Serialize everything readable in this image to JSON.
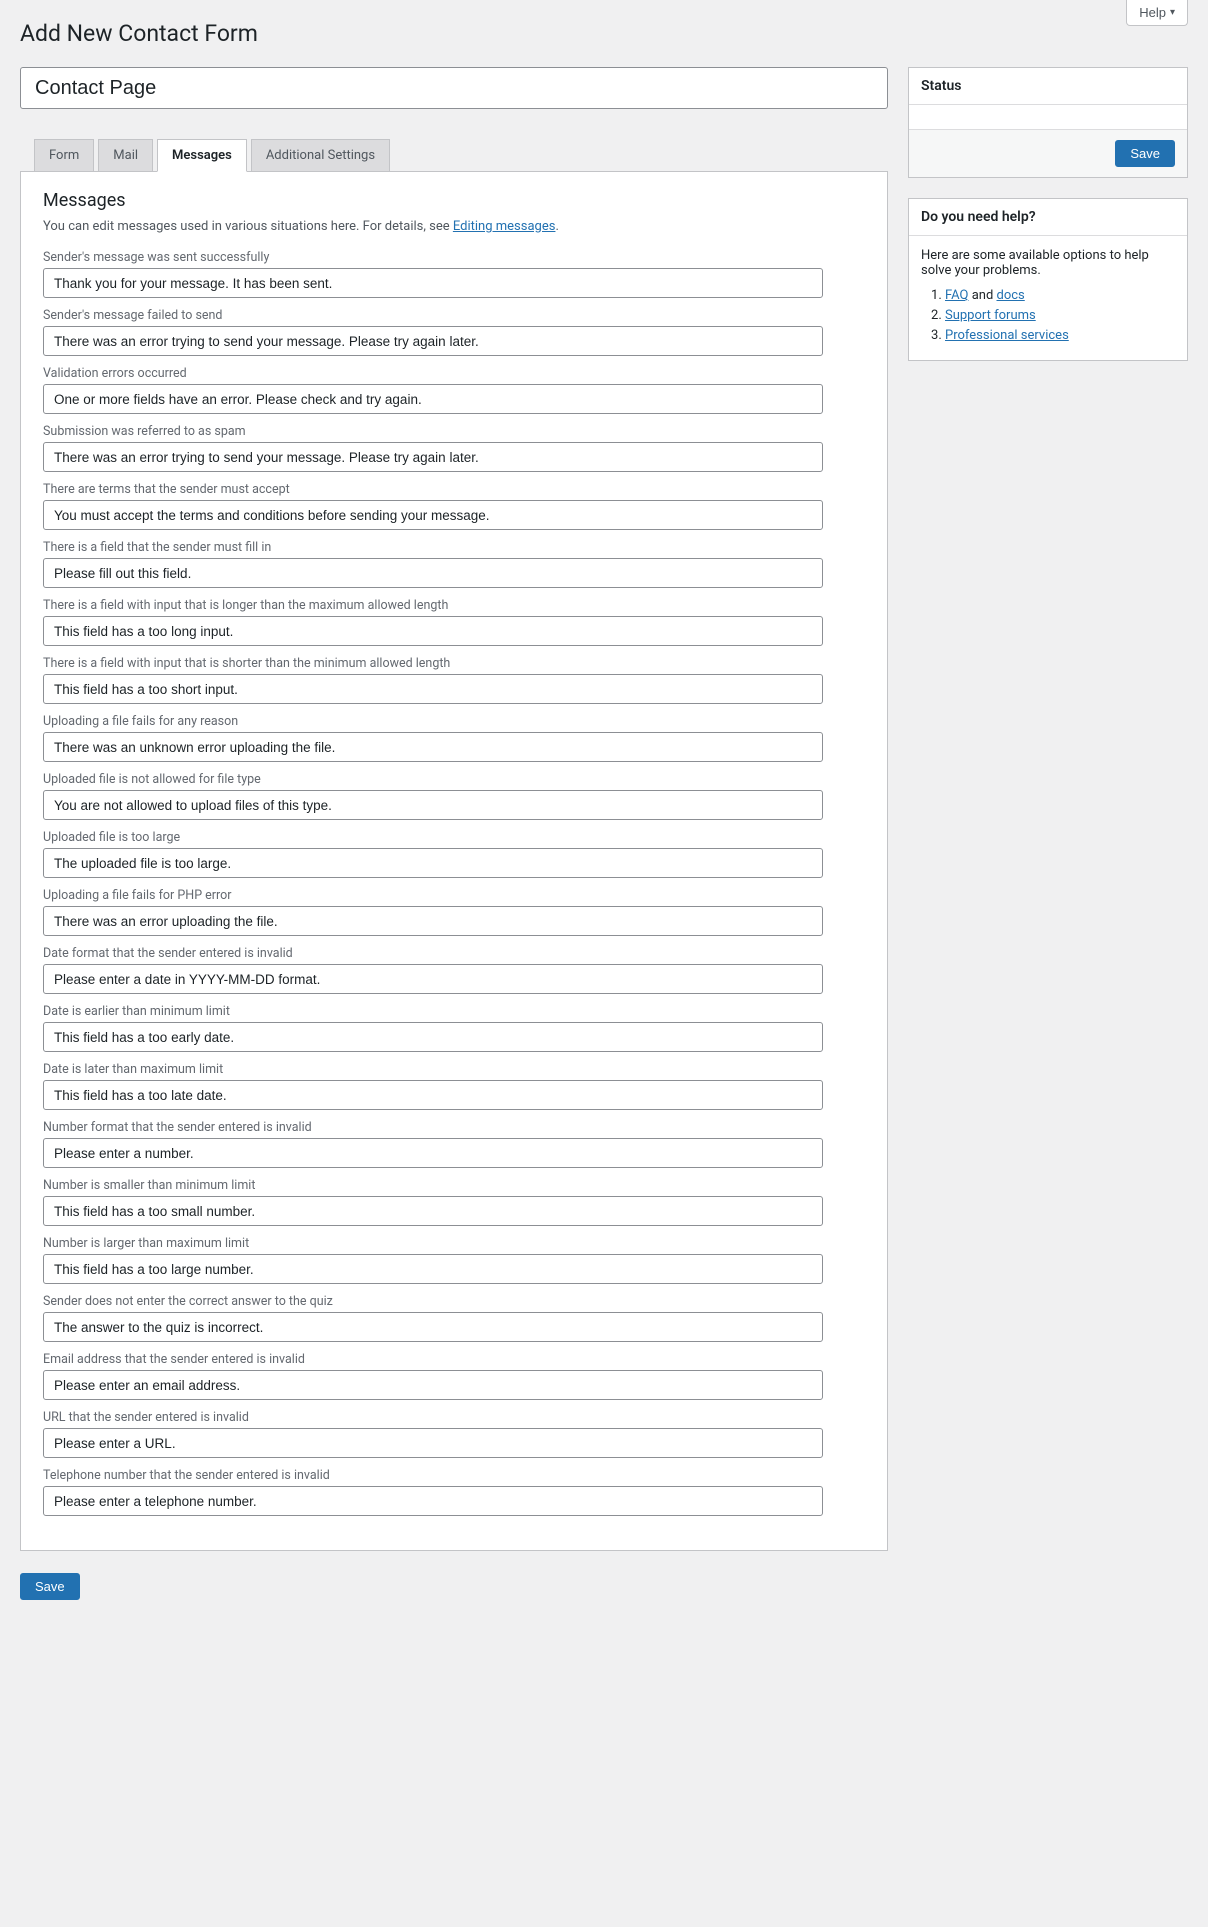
{
  "header": {
    "help_label": "Help",
    "page_title": "Add New Contact Form"
  },
  "title_field": {
    "value": "Contact Page"
  },
  "tabs": [
    {
      "label": "Form"
    },
    {
      "label": "Mail"
    },
    {
      "label": "Messages"
    },
    {
      "label": "Additional Settings"
    }
  ],
  "messages_panel": {
    "heading": "Messages",
    "desc_prefix": "You can edit messages used in various situations here. For details, see ",
    "desc_link": "Editing messages",
    "desc_suffix": ".",
    "rows": [
      {
        "label": "Sender's message was sent successfully",
        "value": "Thank you for your message. It has been sent."
      },
      {
        "label": "Sender's message failed to send",
        "value": "There was an error trying to send your message. Please try again later."
      },
      {
        "label": "Validation errors occurred",
        "value": "One or more fields have an error. Please check and try again."
      },
      {
        "label": "Submission was referred to as spam",
        "value": "There was an error trying to send your message. Please try again later."
      },
      {
        "label": "There are terms that the sender must accept",
        "value": "You must accept the terms and conditions before sending your message."
      },
      {
        "label": "There is a field that the sender must fill in",
        "value": "Please fill out this field."
      },
      {
        "label": "There is a field with input that is longer than the maximum allowed length",
        "value": "This field has a too long input."
      },
      {
        "label": "There is a field with input that is shorter than the minimum allowed length",
        "value": "This field has a too short input."
      },
      {
        "label": "Uploading a file fails for any reason",
        "value": "There was an unknown error uploading the file."
      },
      {
        "label": "Uploaded file is not allowed for file type",
        "value": "You are not allowed to upload files of this type."
      },
      {
        "label": "Uploaded file is too large",
        "value": "The uploaded file is too large."
      },
      {
        "label": "Uploading a file fails for PHP error",
        "value": "There was an error uploading the file."
      },
      {
        "label": "Date format that the sender entered is invalid",
        "value": "Please enter a date in YYYY-MM-DD format."
      },
      {
        "label": "Date is earlier than minimum limit",
        "value": "This field has a too early date."
      },
      {
        "label": "Date is later than maximum limit",
        "value": "This field has a too late date."
      },
      {
        "label": "Number format that the sender entered is invalid",
        "value": "Please enter a number."
      },
      {
        "label": "Number is smaller than minimum limit",
        "value": "This field has a too small number."
      },
      {
        "label": "Number is larger than maximum limit",
        "value": "This field has a too large number."
      },
      {
        "label": "Sender does not enter the correct answer to the quiz",
        "value": "The answer to the quiz is incorrect."
      },
      {
        "label": "Email address that the sender entered is invalid",
        "value": "Please enter an email address."
      },
      {
        "label": "URL that the sender entered is invalid",
        "value": "Please enter a URL."
      },
      {
        "label": "Telephone number that the sender entered is invalid",
        "value": "Please enter a telephone number."
      }
    ]
  },
  "sidebar": {
    "status": {
      "title": "Status",
      "save_label": "Save"
    },
    "help": {
      "title": "Do you need help?",
      "intro": "Here are some available options to help solve your problems.",
      "items": [
        {
          "link1": "FAQ",
          "text": " and ",
          "link2": "docs"
        },
        {
          "link1": "Support forums"
        },
        {
          "link1": "Professional services"
        }
      ]
    }
  },
  "bottom": {
    "save_label": "Save"
  }
}
